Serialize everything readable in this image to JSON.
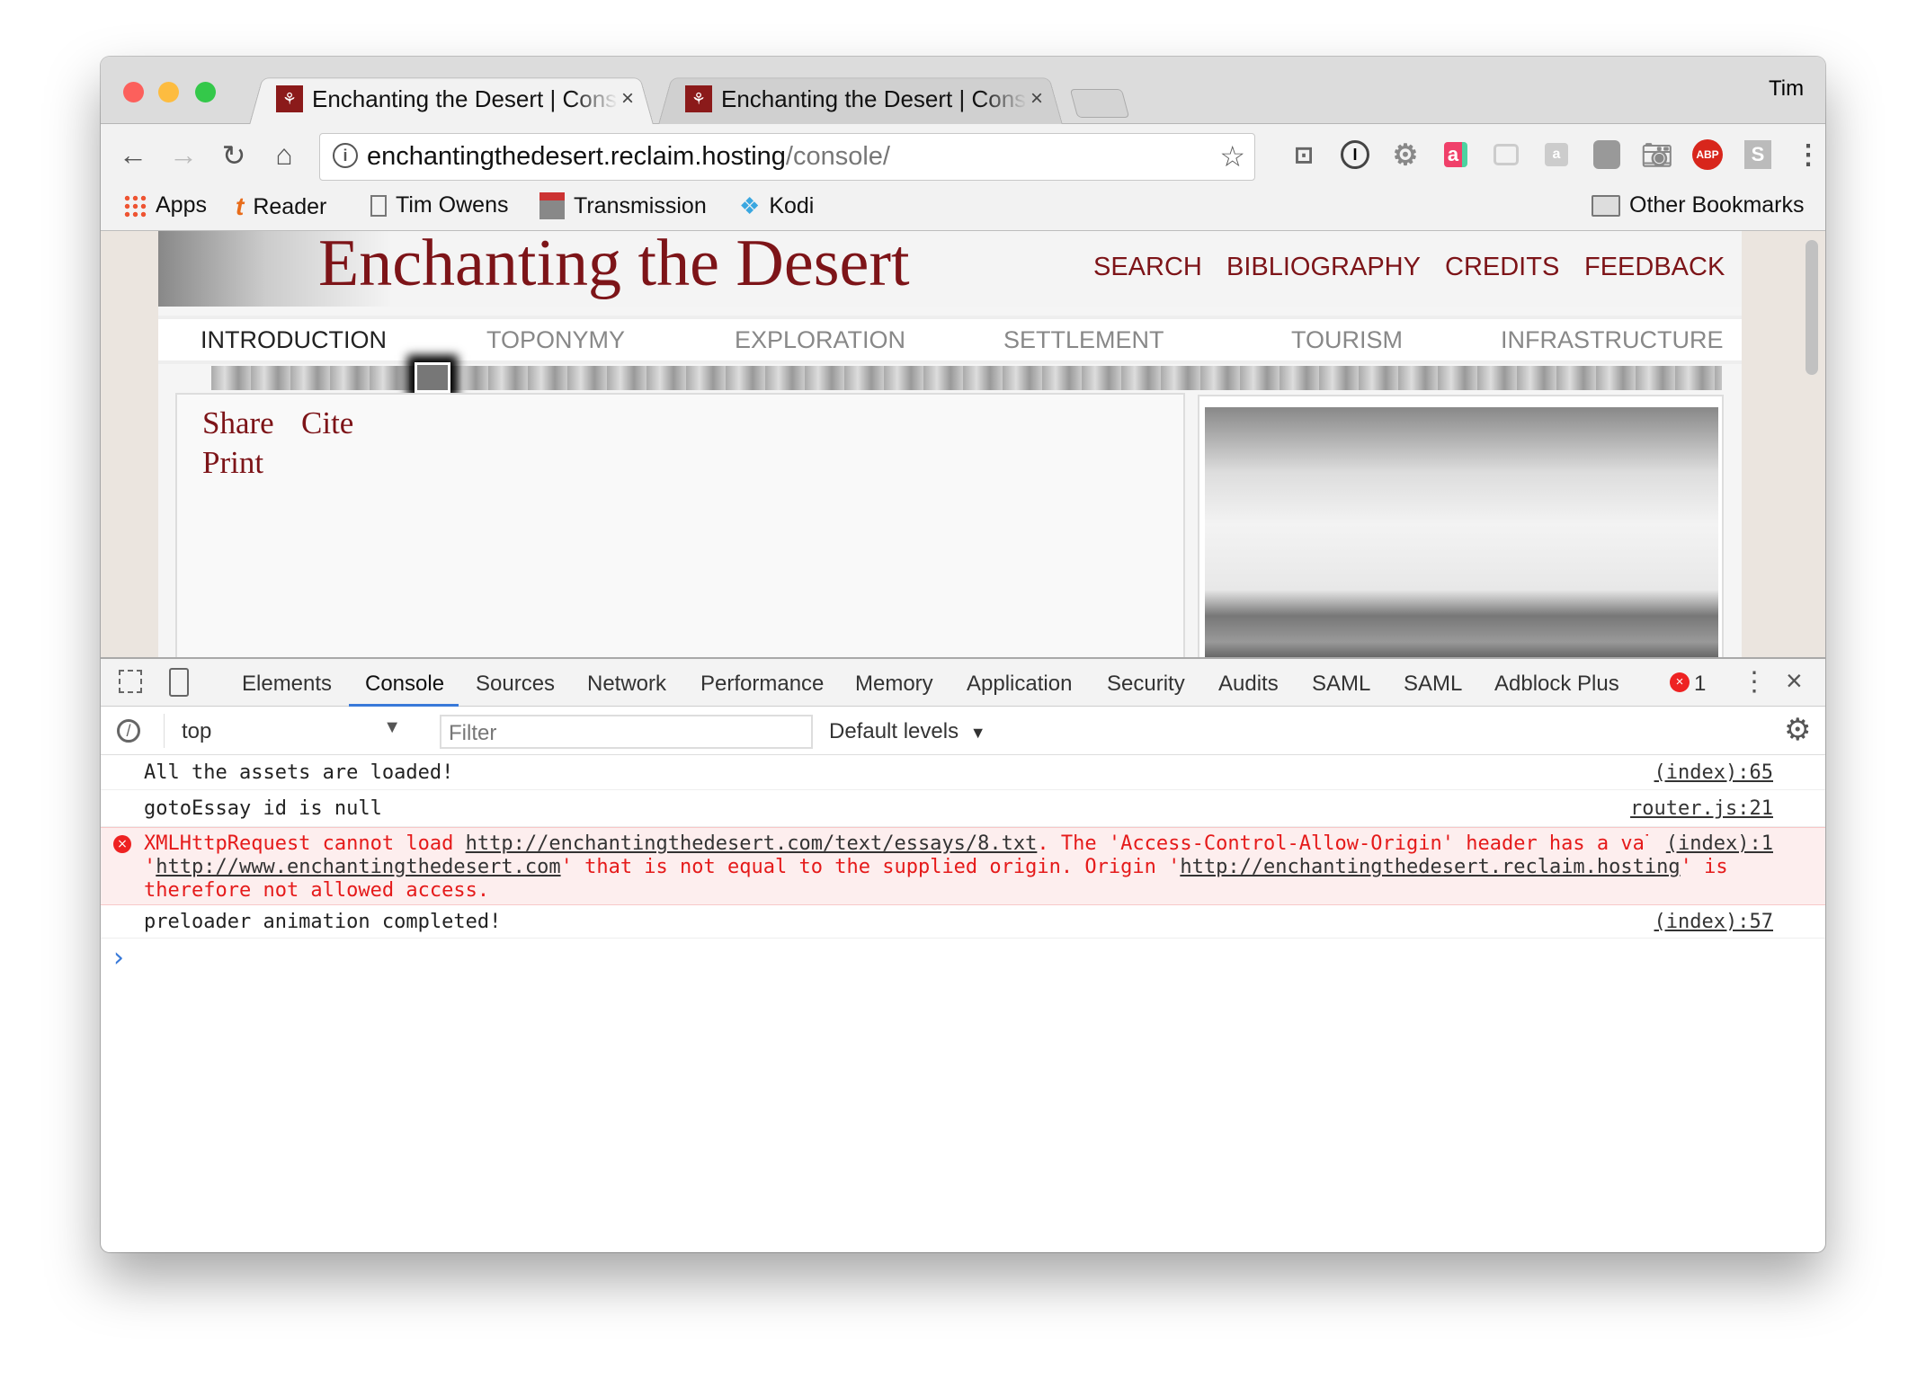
{
  "browser": {
    "tabs": [
      {
        "title": "Enchanting the Desert | Console",
        "active": true
      },
      {
        "title": "Enchanting the Desert | Console",
        "active": false
      }
    ],
    "profile": "Tim",
    "url_host": "enchantingthedesert.reclaim.hosting",
    "url_path": "/console/",
    "extensions": [
      "cast-icon",
      "1password-icon",
      "gear-extension-icon",
      "chat-extension-icon",
      "speech-bubble-icon",
      "chat-extension-grey-icon",
      "shield-extension-icon",
      "camera-icon",
      "adblock-plus-icon",
      "s-extension-icon",
      "menu-kebab-icon"
    ],
    "bookmarks": [
      {
        "label": "Apps",
        "icon": "apps-grid-icon"
      },
      {
        "label": "Reader",
        "icon": "reader-icon"
      },
      {
        "label": "Tim Owens",
        "icon": "page-icon"
      },
      {
        "label": "Transmission",
        "icon": "transmission-icon"
      },
      {
        "label": "Kodi",
        "icon": "kodi-icon"
      }
    ],
    "other_bookmarks": "Other Bookmarks"
  },
  "site": {
    "title": "Enchanting the Desert",
    "top_nav": [
      "SEARCH",
      "BIBLIOGRAPHY",
      "CREDITS",
      "FEEDBACK"
    ],
    "sections": [
      "INTRODUCTION",
      "TOPONYMY",
      "EXPLORATION",
      "SETTLEMENT",
      "TOURISM",
      "INFRASTRUCTURE"
    ],
    "active_section": "INTRODUCTION",
    "actions": {
      "share": "Share",
      "cite": "Cite",
      "print": "Print"
    },
    "brand_color": "#7d1418"
  },
  "devtools": {
    "tabs": [
      "Elements",
      "Console",
      "Sources",
      "Network",
      "Performance",
      "Memory",
      "Application",
      "Security",
      "Audits",
      "SAML",
      "SAML",
      "Adblock Plus"
    ],
    "active_tab": "Console",
    "error_count": "1",
    "context": "top",
    "filter_placeholder": "Filter",
    "levels": "Default levels",
    "messages": [
      {
        "text": "All the assets are loaded!",
        "source": "(index):65"
      },
      {
        "text": "gotoEssay id is null",
        "source": "router.js:21"
      },
      {
        "type": "error",
        "source": "(index):1",
        "parts": [
          "XMLHttpRequest cannot load ",
          "http://enchantingthedesert.com/text/essays/8.txt",
          ". The 'Access-Control-Allow-Origin' header has a value '",
          "http://www.enchantingthedesert.com",
          "' that is not equal to the supplied origin. Origin '",
          "http://enchantingthedesert.reclaim.hosting",
          "' is therefore not allowed access."
        ]
      },
      {
        "text": "preloader animation completed!",
        "source": "(index):57"
      }
    ],
    "prompt": "›"
  }
}
